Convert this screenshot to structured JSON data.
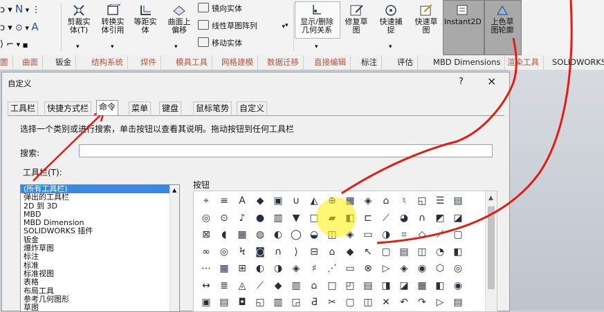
{
  "ribbon": {
    "tools": [
      {
        "label": "剪裁实\n体(T)",
        "icon": "trim-entities-icon"
      },
      {
        "label": "转换实\n体引用",
        "icon": "convert-entities-icon"
      },
      {
        "label": "等距实\n体",
        "icon": "offset-entities-icon"
      },
      {
        "label": "曲面上\n偏移",
        "icon": "offset-on-surface-icon"
      }
    ],
    "small_tools": [
      {
        "label": "镜向实体",
        "icon": "mirror-entities-icon"
      },
      {
        "label": "线性草图阵列",
        "icon": "linear-pattern-icon"
      },
      {
        "label": "移动实体",
        "icon": "move-entities-icon"
      }
    ],
    "right_tools": [
      {
        "label": "显示/删除\n几何关系",
        "icon": "relations-icon"
      },
      {
        "label": "修复草\n图",
        "icon": "repair-sketch-icon"
      },
      {
        "label": "快速捕\n捉",
        "icon": "quick-snaps-icon"
      },
      {
        "label": "快速草\n图",
        "icon": "rapid-sketch-icon"
      },
      {
        "label": "Instant2D",
        "icon": "instant2d-icon"
      },
      {
        "label": "上色草\n图轮廓",
        "icon": "shaded-sketch-icon"
      }
    ]
  },
  "tabs": [
    "圜",
    "曲面",
    "钣金",
    "结构系统",
    "焊件",
    "模具工具",
    "网格建模",
    "数据迁移",
    "直接编辑",
    "标注",
    "评估",
    "MBD Dimensions",
    "渲染工具",
    "SOLIDWORKS"
  ],
  "dialog": {
    "title": "自定义",
    "help": "?",
    "close": "×",
    "tabs": [
      "工具栏",
      "快捷方式栏",
      "命令",
      "菜单",
      "键盘",
      "鼠标笔势",
      "自定义"
    ],
    "active_tab": "命令",
    "instruction": "选择一个类别或进行搜索，单击按钮以查看其说明。拖动按钮到任何工具栏",
    "search_label": "搜索:",
    "search_value": "",
    "toolbars_label": "工具栏(T):",
    "categories": [
      "(所有工具栏)",
      "弹出的工具栏",
      "2D 到 3D",
      "MBD",
      "MBD Dimension",
      "SOLIDWORKS 插件",
      "钣金",
      "爆炸草图",
      "标注",
      "标准",
      "标准视图",
      "表格",
      "布局工具",
      "参考几何图形",
      "草图"
    ],
    "buttons_label": "按钮"
  },
  "colors": {
    "annotation": "#e8190f",
    "selection": "#3b88e0",
    "highlight_cursor": "#fff000"
  }
}
